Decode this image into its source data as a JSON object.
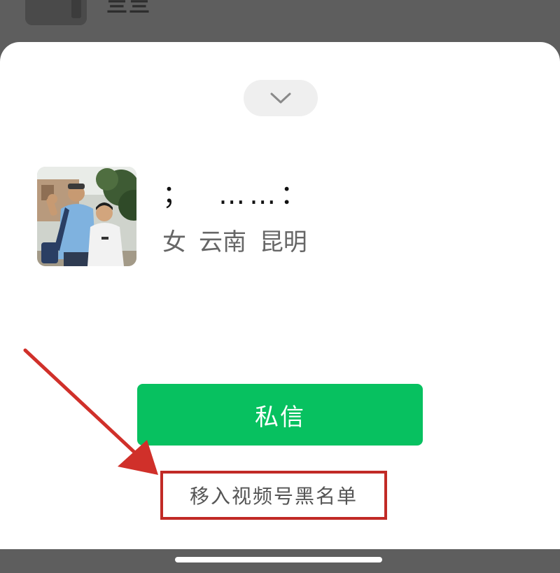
{
  "background": {
    "row_name": "亖亖"
  },
  "sheet": {
    "collapse_icon": "chevron-down-icon",
    "profile": {
      "nickname": "；  ……：",
      "gender": "女",
      "province": "云南",
      "city": "昆明"
    },
    "message_button_label": "私信",
    "blacklist_label": "移入视频号黑名单"
  },
  "colors": {
    "accent_green": "#07c160",
    "annotation_red": "#c12a26",
    "overlay_gray": "#5e5e5e"
  }
}
